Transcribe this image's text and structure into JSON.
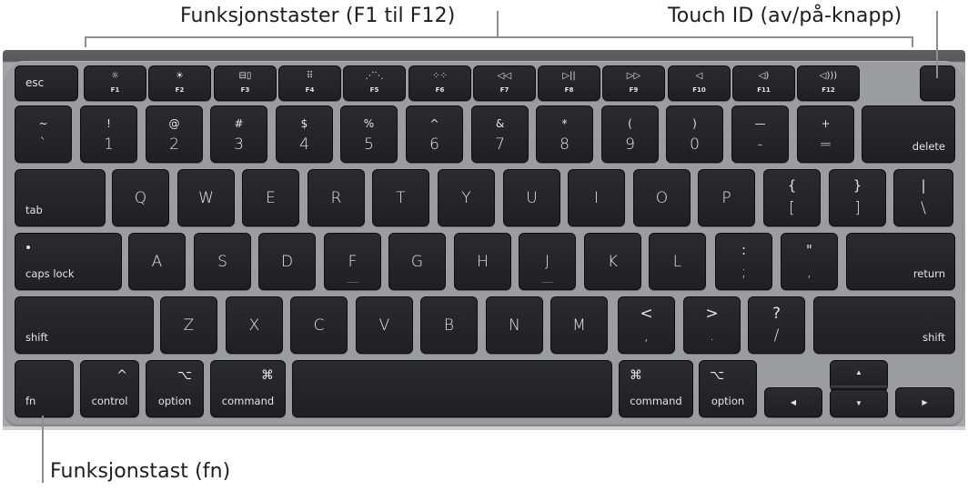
{
  "callouts": {
    "function_keys": "Funksjonstaster (F1 til F12)",
    "touch_id": "Touch ID (av/på-knapp)",
    "fn_key": "Funksjonstast (fn)"
  },
  "colors": {
    "key": "#222224",
    "key_text": "#e4e4e6",
    "body": "#9fa0a3",
    "callout_line": "#8e8e8e"
  },
  "row1": {
    "esc": "esc",
    "fkeys": [
      {
        "icon": "☼",
        "name": "brightness-down-icon",
        "label": "F1"
      },
      {
        "icon": "☀",
        "name": "brightness-up-icon",
        "label": "F2"
      },
      {
        "icon": "⊟▯",
        "name": "mission-control-icon",
        "label": "F3"
      },
      {
        "icon": "⠿",
        "name": "launchpad-icon",
        "label": "F4"
      },
      {
        "icon": "⋰⋱",
        "name": "keyboard-backlight-down-icon",
        "label": "F5"
      },
      {
        "icon": "⁘⁘",
        "name": "keyboard-backlight-up-icon",
        "label": "F6"
      },
      {
        "icon": "◁◁",
        "name": "rewind-icon",
        "label": "F7"
      },
      {
        "icon": "▷||",
        "name": "play-pause-icon",
        "label": "F8"
      },
      {
        "icon": "▷▷",
        "name": "fast-forward-icon",
        "label": "F9"
      },
      {
        "icon": "◁",
        "name": "mute-icon",
        "label": "F10"
      },
      {
        "icon": "◁)",
        "name": "volume-down-icon",
        "label": "F11"
      },
      {
        "icon": "◁)))",
        "name": "volume-up-icon",
        "label": "F12"
      }
    ]
  },
  "row2": {
    "keys": [
      {
        "top": "~",
        "bot": "`"
      },
      {
        "top": "!",
        "bot": "1"
      },
      {
        "top": "@",
        "bot": "2"
      },
      {
        "top": "#",
        "bot": "3"
      },
      {
        "top": "$",
        "bot": "4"
      },
      {
        "top": "%",
        "bot": "5"
      },
      {
        "top": "^",
        "bot": "6"
      },
      {
        "top": "&",
        "bot": "7"
      },
      {
        "top": "*",
        "bot": "8"
      },
      {
        "top": "(",
        "bot": "9"
      },
      {
        "top": ")",
        "bot": "0"
      },
      {
        "top": "—",
        "bot": "-"
      },
      {
        "top": "+",
        "bot": "="
      }
    ],
    "delete": "delete"
  },
  "row3": {
    "tab": "tab",
    "letters": [
      "Q",
      "W",
      "E",
      "R",
      "T",
      "Y",
      "U",
      "I",
      "O",
      "P"
    ],
    "brackets": [
      {
        "top": "{",
        "bot": "["
      },
      {
        "top": "}",
        "bot": "]"
      },
      {
        "top": "|",
        "bot": "\\"
      }
    ]
  },
  "row4": {
    "caps": "caps lock",
    "letters": [
      "A",
      "S",
      "D",
      "F",
      "G",
      "H",
      "J",
      "K",
      "L"
    ],
    "punct": [
      {
        "top": ":",
        "bot": ";"
      },
      {
        "top": "\"",
        "bot": ","
      }
    ],
    "return": "return"
  },
  "row5": {
    "shift": "shift",
    "letters": [
      "Z",
      "X",
      "C",
      "V",
      "B",
      "N",
      "M"
    ],
    "punct": [
      {
        "top": "<",
        "bot": ","
      },
      {
        "top": ">",
        "bot": "."
      },
      {
        "top": "?",
        "bot": "/"
      }
    ],
    "shift_right": "shift"
  },
  "row6": {
    "fn": "fn",
    "control": "control",
    "control_sym": "^",
    "option": "option",
    "option_sym": "⌥",
    "command": "command",
    "command_sym": "⌘",
    "arrows": {
      "up": "▲",
      "down": "▼",
      "left": "◀",
      "right": "▶"
    }
  }
}
